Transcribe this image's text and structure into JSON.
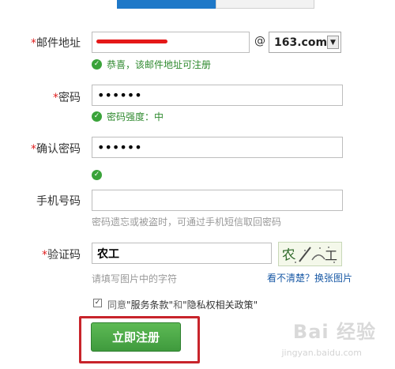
{
  "email": {
    "label": "邮件地址",
    "value": "",
    "at": "@",
    "domain": "163.com",
    "success": "恭喜，该邮件地址可注册"
  },
  "password": {
    "label": "密码",
    "value": "••••••",
    "strength": "密码强度：中"
  },
  "confirm": {
    "label": "确认密码",
    "value": "••••••"
  },
  "phone": {
    "label": "手机号码",
    "value": "",
    "hint": "密码遗忘或被盗时，可通过手机短信取回密码"
  },
  "captcha": {
    "label": "验证码",
    "value": "农工",
    "hint": "请填写图片中的字符",
    "refresh": "看不清楚？换张图片"
  },
  "agreement": {
    "prefix": "同意",
    "terms": "\"服务条款\"",
    "and": "和",
    "privacy": "\"隐私权相关政策\""
  },
  "register_label": "立即注册",
  "watermark": {
    "main": "Bai 经验",
    "sub": "jingyan.baidu.com"
  },
  "colors": {
    "required": "#e02020",
    "success": "#2f8a2f",
    "button": "#4aa847",
    "highlight": "#c8242b"
  }
}
